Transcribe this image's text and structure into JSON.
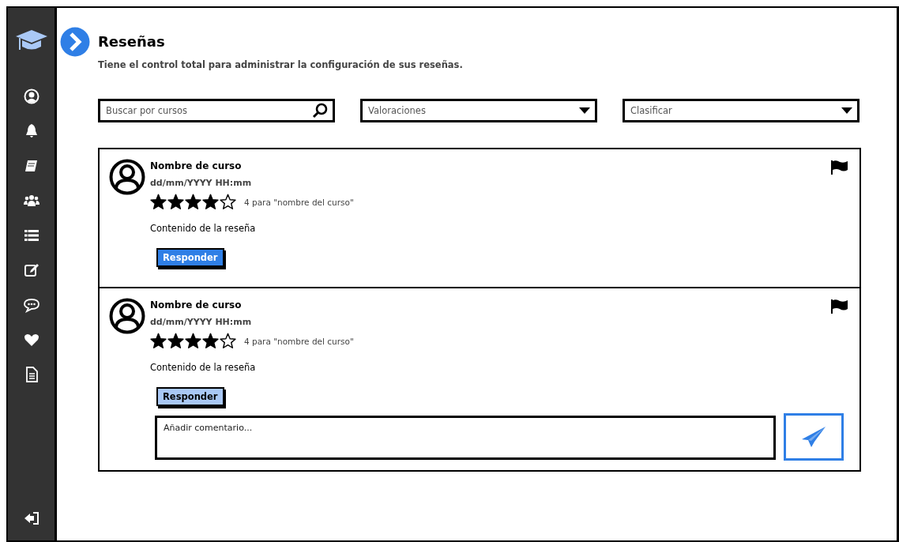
{
  "header": {
    "title": "Reseñas",
    "subtitle": "Tiene el control total para administrar la configuración de sus reseñas."
  },
  "filters": {
    "search": {
      "placeholder": "Buscar por cursos"
    },
    "dropdowns": [
      {
        "value": "Valoraciones"
      },
      {
        "value": "Clasificar"
      }
    ]
  },
  "reviews": [
    {
      "course": "Nombre de curso",
      "date": "dd/mm/YYYY HH:mm",
      "stars": 4,
      "rating_text": "4 para \"nombre del curso\"",
      "content": "Contenido de la reseña",
      "reply_button": "Responder",
      "reply_open": false
    },
    {
      "course": "Nombre de curso",
      "date": "dd/mm/YYYY HH:mm",
      "stars": 4,
      "rating_text": "4 para \"nombre del curso\"",
      "content": "Contenido de la reseña",
      "reply_button": "Responder",
      "reply_open": true,
      "comment": {
        "placeholder": "Añadir comentario..."
      }
    }
  ]
}
